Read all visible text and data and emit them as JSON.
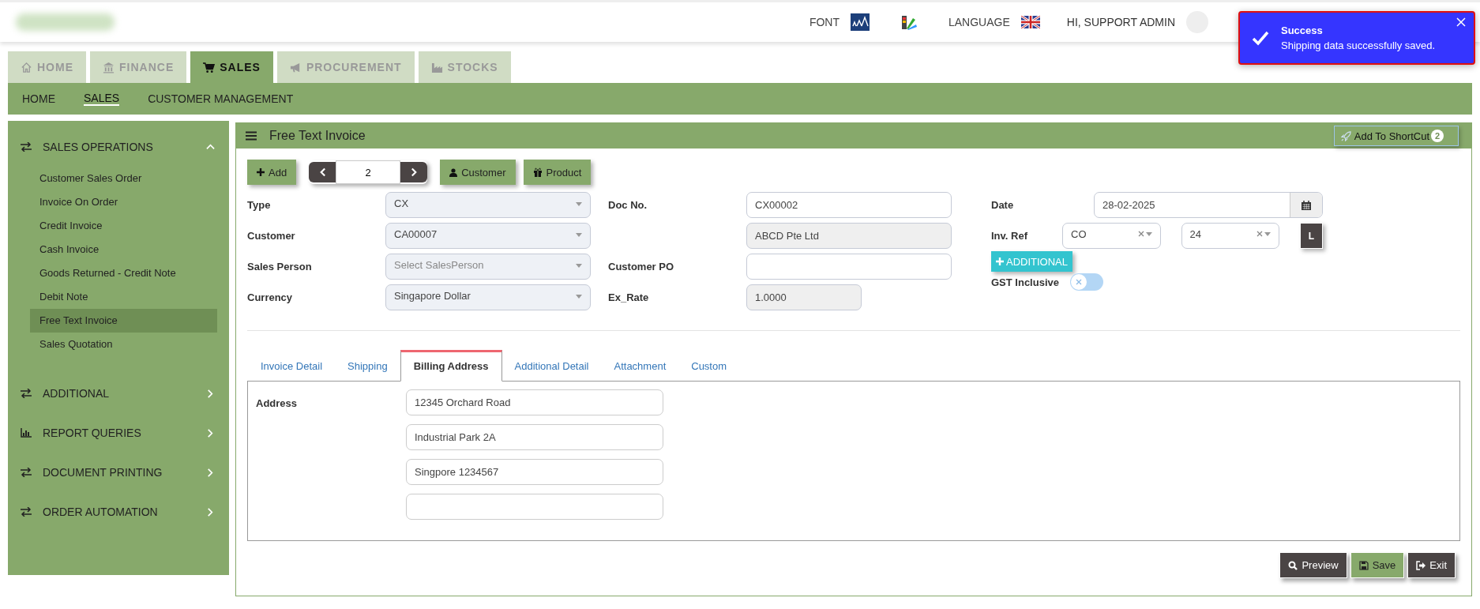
{
  "header": {
    "font_label": "FONT",
    "language_label": "LANGUAGE",
    "user": "HI, SUPPORT ADMIN"
  },
  "toast": {
    "title": "Success",
    "message": "Shipping data successfully saved."
  },
  "module_tabs": [
    {
      "label": "HOME",
      "selected": false
    },
    {
      "label": "FINANCE",
      "selected": false
    },
    {
      "label": "SALES",
      "selected": true
    },
    {
      "label": "PROCUREMENT",
      "selected": false
    },
    {
      "label": "STOCKS",
      "selected": false
    }
  ],
  "sub_nav": [
    {
      "label": "HOME",
      "selected": false
    },
    {
      "label": "SALES",
      "selected": true
    },
    {
      "label": "CUSTOMER MANAGEMENT",
      "selected": false
    }
  ],
  "sidebar": {
    "sections": [
      {
        "label": "SALES OPERATIONS",
        "expanded": true,
        "items": [
          {
            "label": "Customer Sales Order",
            "selected": false
          },
          {
            "label": "Invoice On Order",
            "selected": false
          },
          {
            "label": "Credit Invoice",
            "selected": false
          },
          {
            "label": "Cash Invoice",
            "selected": false
          },
          {
            "label": "Goods Returned - Credit Note",
            "selected": false
          },
          {
            "label": "Debit Note",
            "selected": false
          },
          {
            "label": "Free Text Invoice",
            "selected": true
          },
          {
            "label": "Sales Quotation",
            "selected": false
          }
        ]
      },
      {
        "label": "ADDITIONAL",
        "expanded": false
      },
      {
        "label": "REPORT QUERIES",
        "expanded": false
      },
      {
        "label": "DOCUMENT PRINTING",
        "expanded": false
      },
      {
        "label": "ORDER AUTOMATION",
        "expanded": false
      }
    ]
  },
  "panel": {
    "title": "Free Text Invoice",
    "shortcut": {
      "label": "Add To ShortCut",
      "badge": "2"
    }
  },
  "toolbar": {
    "add": "Add",
    "pager_value": "2",
    "customer": "Customer",
    "product": "Product"
  },
  "form_columns": [
    [
      {
        "label": "Type",
        "kind": "select",
        "value": "CX"
      },
      {
        "label": "Customer",
        "kind": "select",
        "value": "CA00007"
      },
      {
        "label": "Sales Person",
        "kind": "select",
        "placeholder": "Select SalesPerson"
      },
      {
        "label": "Currency",
        "kind": "select",
        "value": "Singapore Dollar"
      }
    ],
    [
      {
        "label": "Doc No.",
        "kind": "text",
        "value": "CX00002"
      },
      {
        "kind": "readonly",
        "value": "ABCD Pte Ltd"
      },
      {
        "label": "Customer PO",
        "kind": "text"
      },
      {
        "label": "Ex_Rate",
        "kind": "readonly_short",
        "value": "1.0000"
      }
    ]
  ],
  "date": {
    "label": "Date",
    "value": "28-02-2025"
  },
  "inv_ref": {
    "label": "Inv. Ref",
    "selects": [
      {
        "value": "CO"
      },
      {
        "value": "24"
      }
    ],
    "button": "L"
  },
  "additional_button": "ADDITIONAL",
  "gst": {
    "label": "GST Inclusive",
    "on": false
  },
  "tabs": [
    {
      "label": "Invoice Detail",
      "selected": false
    },
    {
      "label": "Shipping",
      "selected": false
    },
    {
      "label": "Billing Address",
      "selected": true
    },
    {
      "label": "Additional Detail",
      "selected": false
    },
    {
      "label": "Attachment",
      "selected": false
    },
    {
      "label": "Custom",
      "selected": false
    }
  ],
  "billing": {
    "label": "Address",
    "lines": [
      "12345 Orchard Road",
      "Industrial Park 2A",
      "Singpore 1234567"
    ]
  },
  "actions": [
    {
      "label": "Preview",
      "kind": "preview"
    },
    {
      "label": "Save",
      "kind": "save"
    },
    {
      "label": "Exit",
      "kind": "exit"
    }
  ]
}
